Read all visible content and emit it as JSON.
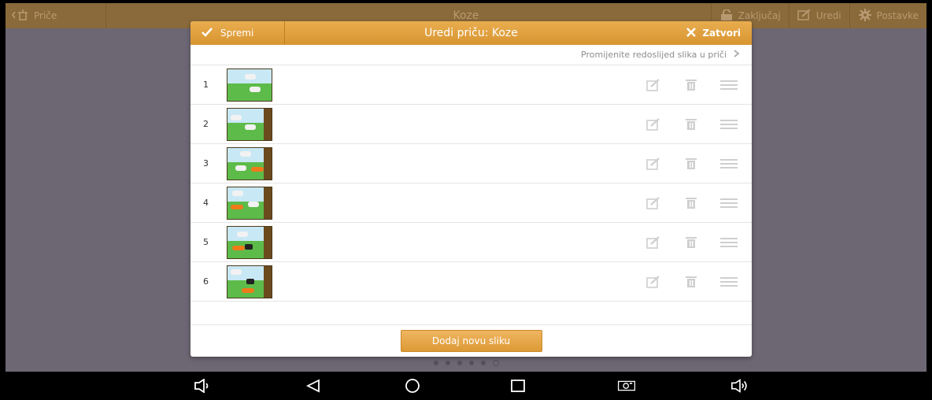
{
  "appbar": {
    "back_label": "Priče",
    "title": "Koze",
    "lock_label": "Zaključaj",
    "edit_label": "Uredi",
    "settings_label": "Postavke"
  },
  "dialog": {
    "save_label": "Spremi",
    "title": "Uredi priču: Koze",
    "close_label": "Zatvori",
    "reorder_hint": "Promijenite redoslijed slika u priči",
    "add_button_label": "Dodaj novu sliku",
    "rows": [
      {
        "number": "1"
      },
      {
        "number": "2"
      },
      {
        "number": "3"
      },
      {
        "number": "4"
      },
      {
        "number": "5"
      },
      {
        "number": "6"
      }
    ]
  },
  "pager": {
    "count": 6,
    "current": 6
  },
  "colors": {
    "accent": "#e0a040",
    "appbar": "#8a6a3a",
    "backdrop": "#6d6774",
    "icon_gray": "#cfcfcf"
  },
  "icons": [
    "edit-icon",
    "trash-icon",
    "drag-handle-icon",
    "checkmark-icon",
    "close-icon",
    "lock-icon",
    "gear-icon",
    "back-icon"
  ]
}
